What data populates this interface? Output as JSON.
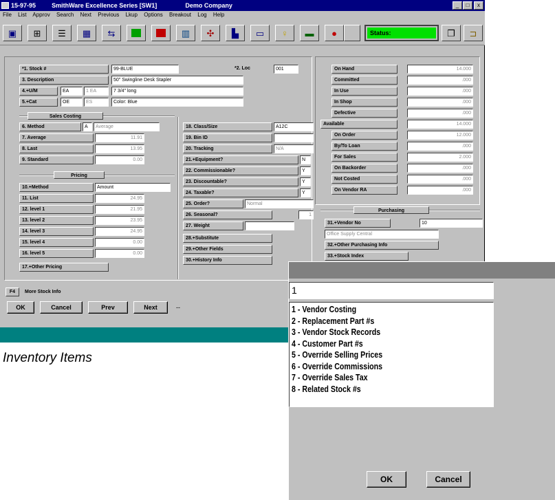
{
  "window": {
    "title_date": "15-97-95",
    "title_app": "SmithWare Excellence Series [SW1]",
    "title_company": "Demo Company",
    "controls": [
      "_",
      "□",
      "x"
    ]
  },
  "menu": [
    "File",
    "List",
    "Approv",
    "Search",
    "Next",
    "Previous",
    "Lkup",
    "Options",
    "Breakout",
    "Log",
    "Help"
  ],
  "toolbar": {
    "status_label": "Status:"
  },
  "stock": {
    "labels": {
      "stock_no": "*1. Stock #",
      "description": "3. Description",
      "um": "4.+U/M",
      "cat": "5.+Cat",
      "loc": "*2. Loc"
    },
    "values": {
      "stock_no": "99-BLUE",
      "description": "50\" Swingline Desk Stapler",
      "um_code": "EA",
      "um_qty": "1 EA",
      "um_desc": "7 3/4\" long",
      "cat_code": "OE",
      "cat_sub": "ES",
      "cat_desc": "Color: Blue",
      "loc": "001"
    }
  },
  "sales_costing": {
    "header": "Sales Costing",
    "labels": [
      "6. Method",
      "7. Average",
      "8. Last",
      "9. Standard"
    ],
    "method_code": "A",
    "method_value": "Average",
    "values": [
      "",
      "11.91",
      "13.95",
      "0.00"
    ]
  },
  "pricing": {
    "header": "Pricing",
    "labels": [
      "10.+Method",
      "11. List",
      "12. level 1",
      "13. level 2",
      "14. level 3",
      "15. level 4",
      "16. level 5"
    ],
    "values": [
      "Amount",
      "24.95",
      "21.95",
      "23.95",
      "24.95",
      "0.00",
      "0.00"
    ],
    "other_label": "17.+Other Pricing"
  },
  "middle": {
    "labels": [
      "18. Class/Size",
      "19. Bin ID",
      "20. Tracking",
      "21.+Equipment?",
      "22. Commissionable?",
      "23. Discountable?",
      "24. Taxable?",
      "25. Order?",
      "26. Seasonal?",
      "27. Weight",
      "28.+Substitute",
      "29.+Other Fields",
      "30.+History Info"
    ],
    "class_value": "A12C",
    "bin_value": "",
    "tracking_value": "N/A",
    "equipment": "N",
    "commissionable": "Y",
    "discountable": "Y",
    "taxable": "Y",
    "order_value": "Normal",
    "seasonal": "1",
    "weight": ""
  },
  "quantities": {
    "labels": [
      "On Hand",
      "Committed",
      "In Use",
      "In Shop",
      "Defective",
      "Available",
      "On Order",
      "By/To Loan",
      "For Sales",
      "On Backorder",
      "Not Costed",
      "On Vendor RA"
    ],
    "values": [
      "14.000",
      ".000",
      ".000",
      ".000",
      ".000",
      "14.000",
      "12.000",
      ".000",
      "2.000",
      ".000",
      ".000",
      ".000"
    ]
  },
  "purchasing": {
    "header": "Purchasing",
    "vendor_label": "31.+Vendor No",
    "vendor_value": "10",
    "vendor_name": "Office Supply Central",
    "other_label": "32.+Other Purchasing Info",
    "stock_index_label": "33.+Stock Index"
  },
  "footer": {
    "f4_key": "F4",
    "f4_label": "More Stock Info",
    "buttons": [
      "OK",
      "Cancel",
      "Prev",
      "Next"
    ],
    "dash": "--"
  },
  "caption": "Inventory Items",
  "dialog": {
    "input_value": "1",
    "items": [
      "1 - Vendor Costing",
      "2 - Replacement Part #s",
      "3 - Vendor Stock Records",
      "4 - Customer Part #s",
      "5 - Override Selling Prices",
      "6 - Override Commissions",
      "7 - Override Sales Tax",
      "8 - Related Stock #s"
    ],
    "ok_label": "OK",
    "cancel_label": "Cancel"
  },
  "colors": {
    "title_bar": "#000080",
    "face": "#c0c0c0",
    "status_green": "#00e000",
    "teal_bar": "#008080",
    "dialog_title": "#808080"
  }
}
